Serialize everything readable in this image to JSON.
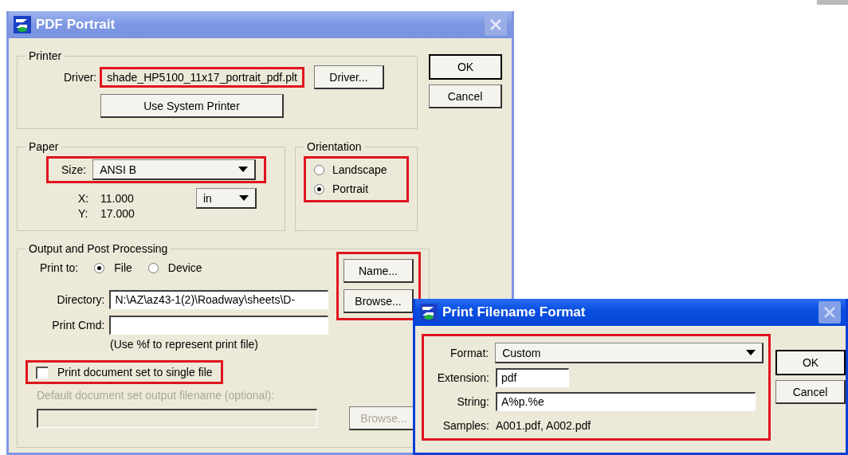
{
  "main_window": {
    "title": "PDF Portrait",
    "active": false,
    "printer": {
      "legend": "Printer",
      "driver_label": "Driver:",
      "driver_value": "shade_HP5100_11x17_portrait_pdf.plt",
      "driver_highlighted": true,
      "driver_button": "Driver...",
      "system_button": "Use System Printer"
    },
    "paper": {
      "legend": "Paper",
      "size_label": "Size:",
      "size_value": "ANSI B",
      "size_highlighted": true,
      "x_label": "X:",
      "x_value": "11.000",
      "y_label": "Y:",
      "y_value": "17.000",
      "units": "in"
    },
    "orientation": {
      "legend": "Orientation",
      "highlighted": true,
      "options": [
        {
          "label": "Landscape",
          "selected": false
        },
        {
          "label": "Portrait",
          "selected": true
        }
      ]
    },
    "output": {
      "legend": "Output and Post Processing",
      "print_to_label": "Print to:",
      "print_to_options": [
        {
          "label": "File",
          "selected": true
        },
        {
          "label": "Device",
          "selected": false
        }
      ],
      "buttons_highlighted": true,
      "name_button": "Name...",
      "browse_button": "Browse...",
      "directory_label": "Directory:",
      "directory_value": "N:\\AZ\\az43-1(2)\\Roadway\\sheets\\D-",
      "cmd_label": "Print Cmd:",
      "hint": "(Use %f to represent print file)",
      "single_file": {
        "label": "Print document set to single file",
        "checked": false,
        "highlighted": true
      },
      "default_label": "Default document set output filename (optional):",
      "default_disabled": true,
      "default_browse": "Browse..."
    },
    "buttons": [
      "OK",
      "Cancel"
    ]
  },
  "format_window": {
    "title": "Print Filename Format",
    "active": true,
    "highlighted": true,
    "format_label": "Format:",
    "format_value": "Custom",
    "extension_label": "Extension:",
    "extension_value": "pdf",
    "string_label": "String:",
    "string_value": "A%p.%e",
    "samples_label": "Samples:",
    "samples_value": "A001.pdf, A002.pdf",
    "buttons": [
      "OK",
      "Cancel"
    ]
  }
}
